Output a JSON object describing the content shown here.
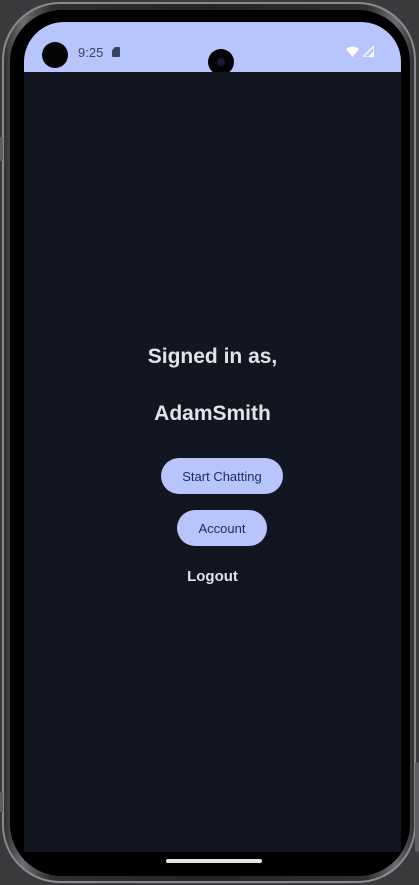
{
  "status_bar": {
    "time": "9:25",
    "icons": [
      "sd-card-icon",
      "wifi-icon",
      "cell-signal-icon"
    ]
  },
  "main": {
    "signed_in_label": "Signed in as,",
    "username": "AdamSmith",
    "start_chatting_label": "Start Chatting",
    "account_label": "Account",
    "logout_label": "Logout"
  },
  "colors": {
    "accent": "#b8c5fc",
    "background": "#121620",
    "text": "#e2e2e9",
    "button_text": "#1c2a5c"
  }
}
